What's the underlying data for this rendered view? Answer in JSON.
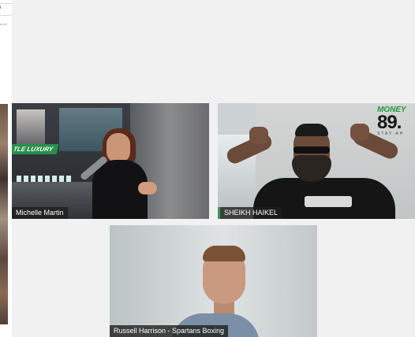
{
  "search": {
    "icon": "search-icon",
    "truncated_text": "ende"
  },
  "participants": [
    {
      "name": "Michelle Martin",
      "studio_sign": "TLE LUXURY"
    },
    {
      "name": "SHEIKH HAIKEL",
      "logo": {
        "word": "MONEY",
        "number": "89.",
        "tagline": "STAY AH"
      }
    },
    {
      "name": "Russell Harrison - Spartans Boxing"
    }
  ],
  "colors": {
    "accent_green": "#3a9b57",
    "label_bg": "#1e1e1e"
  }
}
